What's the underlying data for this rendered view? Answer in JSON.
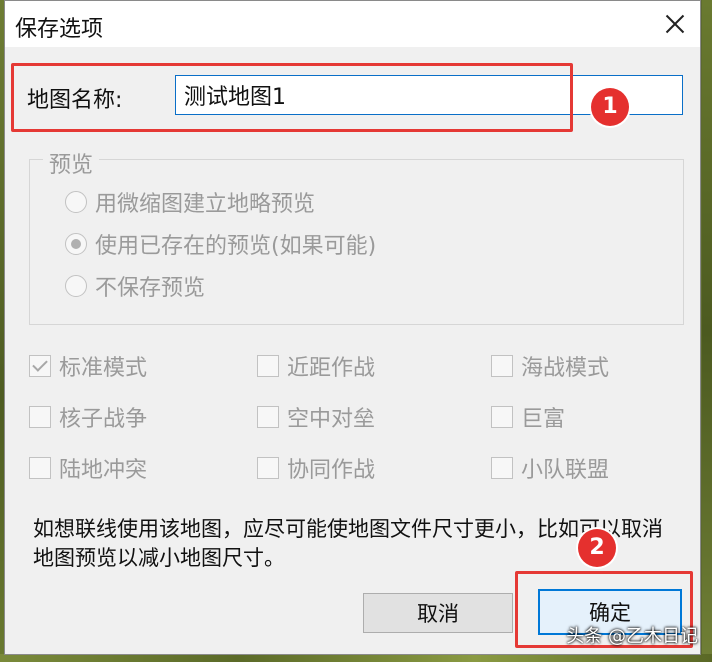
{
  "window": {
    "title": "保存选项",
    "close_icon": "close-icon"
  },
  "map_name": {
    "label": "地图名称:",
    "value": "测试地图1"
  },
  "preview": {
    "legend": "预览",
    "options": [
      {
        "label": "用微缩图建立地略预览",
        "checked": false
      },
      {
        "label": "使用已存在的预览(如果可能)",
        "checked": true
      },
      {
        "label": "不保存预览",
        "checked": false
      }
    ]
  },
  "modes": [
    {
      "label": "标准模式",
      "checked": true
    },
    {
      "label": "近距作战",
      "checked": false
    },
    {
      "label": "海战模式",
      "checked": false
    },
    {
      "label": "核子战争",
      "checked": false
    },
    {
      "label": "空中对垒",
      "checked": false
    },
    {
      "label": "巨富",
      "checked": false
    },
    {
      "label": "陆地冲突",
      "checked": false
    },
    {
      "label": "协同作战",
      "checked": false
    },
    {
      "label": "小队联盟",
      "checked": false
    }
  ],
  "note": "如想联线使用该地图，应尽可能使地图文件尺寸更小，比如可以取消地图预览以减小地图尺寸。",
  "buttons": {
    "cancel": "取消",
    "ok": "确定"
  },
  "annotations": {
    "step1": "1",
    "step2": "2",
    "highlight_color": "#e53935"
  },
  "watermark": "头条 @乙木日记"
}
